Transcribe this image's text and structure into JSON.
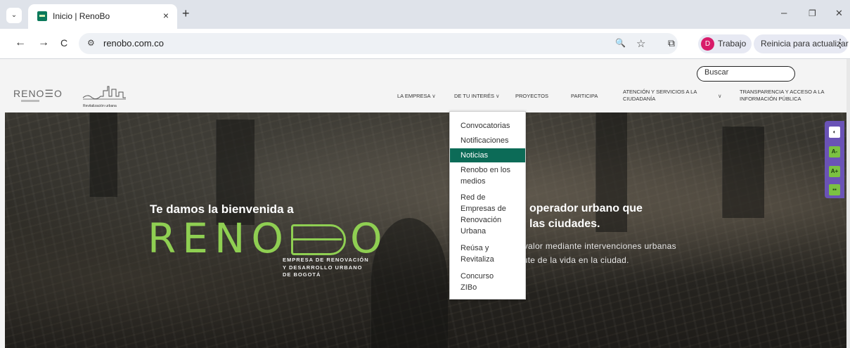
{
  "browser": {
    "tab": {
      "title": "Inicio | RenoBo",
      "close": "×"
    },
    "new_tab": "+",
    "tab_list": "⌄",
    "window": {
      "minimize": "–",
      "restore": "❐",
      "close": "✕"
    },
    "nav": {
      "back": "←",
      "forward": "→",
      "reload": "C"
    },
    "url": "renobo.com.co",
    "site_info_icon": "⚙",
    "omnibox_icons": {
      "zoom": "🔍",
      "bookmark": "☆"
    },
    "extensions_icon": "⧉",
    "profile": {
      "initial": "D",
      "label": "Trabajo"
    },
    "update_label": "Reinicia para actualizar",
    "menu_dots": "⋮"
  },
  "page": {
    "search_placeholder": "Buscar",
    "logo": {
      "text": "RENO☰O",
      "skyline_caption": "Revitalización urbana"
    },
    "nav": {
      "empresa": "LA EMPRESA",
      "interes": "DE TU INTERÉS",
      "proyectos": "PROYECTOS",
      "participa": "PARTICIPA",
      "atencion_1": "ATENCIÓN Y SERVICIOS A LA",
      "atencion_2": "CIUDADANÍA",
      "transparencia_1": "TRANSPARENCIA Y ACCESO A LA",
      "transparencia_2": "INFORMACIÓN PÚBLICA",
      "chevron": "∨"
    },
    "dropdown": [
      {
        "label": "Convocatorias"
      },
      {
        "label": "Notificaciones"
      },
      {
        "label": "Noticias",
        "active": true
      },
      {
        "label": "Renobo en los medios"
      },
      {
        "label": "Red de Empresas de Renovación Urbana"
      },
      {
        "label": "Reúsa y Revitaliza"
      },
      {
        "label": "Concurso ZIBo"
      }
    ],
    "hero": {
      "welcome": "Te damos la bienvenida a",
      "brand_left": "RENO",
      "brand_right": "O",
      "subtitle_1": "EMPRESA DE RENOVACIÓN",
      "subtitle_2": "Y DESARROLLO URBANO",
      "subtitle_3": "DE BOGOTÁ",
      "title_1": "operador urbano que",
      "title_2": "las ciudades.",
      "desc_1": "Agregamos valor mediante intervenciones urbanas",
      "desc_2": "para el disfrute de la vida en la ciudad."
    },
    "accessibility": [
      {
        "label": "◐"
      },
      {
        "label": "A-"
      },
      {
        "label": "A+"
      },
      {
        "label": "▪▪"
      }
    ],
    "colors": {
      "brand_green": "#8fcf52",
      "active_item": "#0c6b57",
      "a11y_bar": "#6a53b6"
    }
  }
}
